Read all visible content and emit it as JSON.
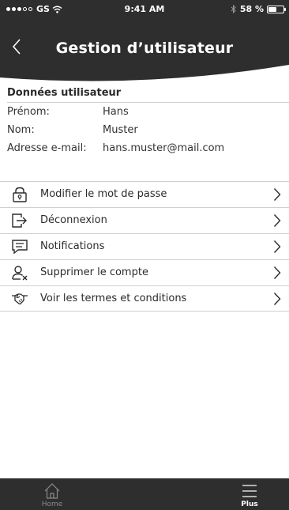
{
  "status_bar": {
    "carrier": "GS",
    "time": "9:41 AM",
    "battery_text": "58 %",
    "battery_level": 0.58
  },
  "header": {
    "title": "Gestion d’utilisateur",
    "back_icon": "chevron-left-icon"
  },
  "user_data": {
    "title": "Données utilisateur",
    "fields": [
      {
        "label": "Prénom:",
        "value": "Hans"
      },
      {
        "label": "Nom:",
        "value": "Muster"
      },
      {
        "label": "Adresse e-mail:",
        "value": "hans.muster@mail.com"
      }
    ]
  },
  "menu": {
    "items": [
      {
        "label": "Modifier le mot de passe",
        "icon": "lock-icon"
      },
      {
        "label": "Déconnexion",
        "icon": "logout-icon"
      },
      {
        "label": "Notifications",
        "icon": "message-icon"
      },
      {
        "label": "Supprimer le compte",
        "icon": "delete-user-icon"
      },
      {
        "label": "Voir les termes et conditions",
        "icon": "handshake-icon"
      }
    ]
  },
  "tab_bar": {
    "home_label": "Home",
    "more_label": "Plus"
  },
  "colors": {
    "header": "#2e2e2e",
    "divider": "#cfcfcf",
    "text": "#2b2b2b"
  }
}
